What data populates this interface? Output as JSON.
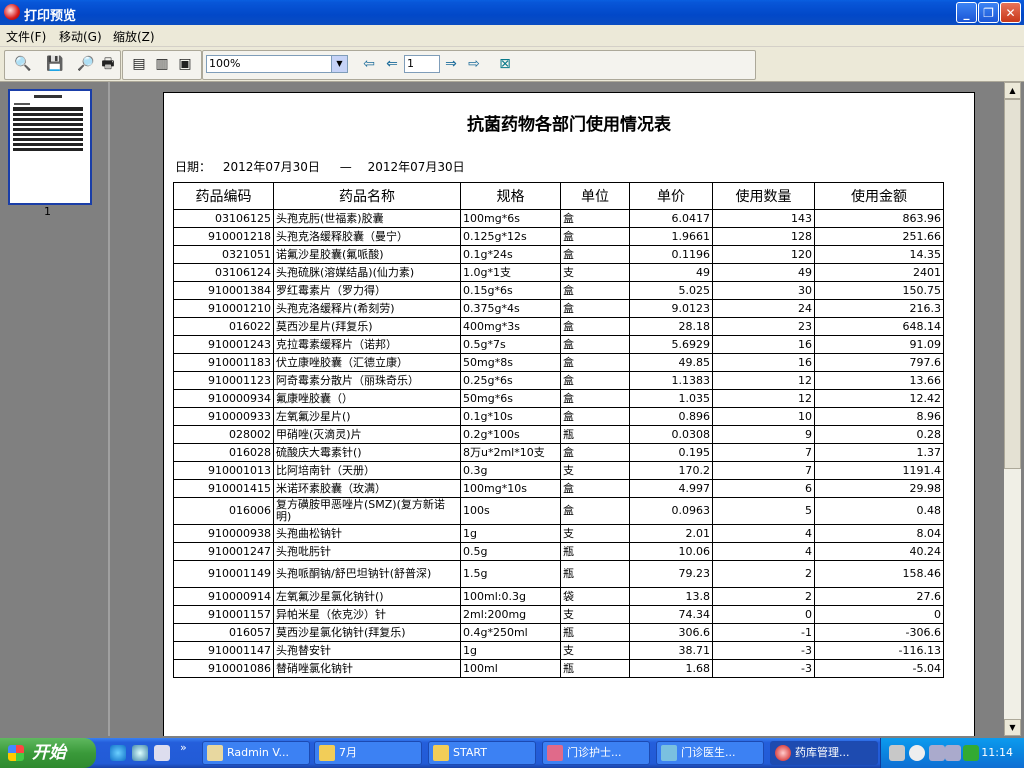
{
  "window": {
    "title": "打印预览",
    "minimize": "_",
    "maximize": "❐",
    "close": "✕"
  },
  "menu": [
    "文件(F)",
    "移动(G)",
    "缩放(Z)"
  ],
  "toolbar": {
    "zoom_value": "100%",
    "page_value": "1"
  },
  "thumbnails": {
    "page_label": "1"
  },
  "report": {
    "title": "抗菌药物各部门使用情况表",
    "date_label": "日期：",
    "date_from": "2012年07月30日",
    "date_sep": "—",
    "date_to": "2012年07月30日",
    "columns": [
      "药品编码",
      "药品名称",
      "规格",
      "单位",
      "单价",
      "使用数量",
      "使用金额"
    ],
    "rows": [
      [
        "03106125",
        "头孢克肟(世福素)胶囊",
        "100mg*6s",
        "盒",
        "6.0417",
        "143",
        "863.96"
      ],
      [
        "910001218",
        "头孢克洛缓释胶囊（曼宁）",
        "0.125g*12s",
        "盒",
        "1.9661",
        "128",
        "251.66"
      ],
      [
        "0321051",
        "诺氟沙星胶囊(氟哌酸)",
        "0.1g*24s",
        "盒",
        "0.1196",
        "120",
        "14.35"
      ],
      [
        "03106124",
        "头孢硫脒(溶媒结晶)(仙力素)",
        "1.0g*1支",
        "支",
        "49",
        "49",
        "2401"
      ],
      [
        "910001384",
        "罗红霉素片（罗力得）",
        "0.15g*6s",
        "盒",
        "5.025",
        "30",
        "150.75"
      ],
      [
        "910001210",
        "头孢克洛缓释片(希刻劳)",
        "0.375g*4s",
        "盒",
        "9.0123",
        "24",
        "216.3"
      ],
      [
        "016022",
        "莫西沙星片(拜复乐)",
        "400mg*3s",
        "盒",
        "28.18",
        "23",
        "648.14"
      ],
      [
        "910001243",
        "克拉霉素缓释片（诺邦）",
        "0.5g*7s",
        "盒",
        "5.6929",
        "16",
        "91.09"
      ],
      [
        "910001183",
        "伏立康唑胶囊（汇德立康）",
        "50mg*8s",
        "盒",
        "49.85",
        "16",
        "797.6"
      ],
      [
        "910001123",
        "阿奇霉素分散片（丽珠奇乐）",
        "0.25g*6s",
        "盒",
        "1.1383",
        "12",
        "13.66"
      ],
      [
        "910000934",
        "氟康唑胶囊（）",
        "50mg*6s",
        "盒",
        "1.035",
        "12",
        "12.42"
      ],
      [
        "910000933",
        "左氧氟沙星片()",
        "0.1g*10s",
        "盒",
        "0.896",
        "10",
        "8.96"
      ],
      [
        "028002",
        "甲硝唑(灭滴灵)片",
        "0.2g*100s",
        "瓶",
        "0.0308",
        "9",
        "0.28"
      ],
      [
        "016028",
        "硫酸庆大霉素针()",
        "8万u*2ml*10支",
        "盒",
        "0.195",
        "7",
        "1.37"
      ],
      [
        "910001013",
        "比阿培南针（天册）",
        "0.3g",
        "支",
        "170.2",
        "7",
        "1191.4"
      ],
      [
        "910001415",
        "米诺环素胶囊（玫满）",
        "100mg*10s",
        "盒",
        "4.997",
        "6",
        "29.98"
      ],
      [
        "016006",
        "复方磺胺甲恶唑片(SMZ)(复方新诺明)",
        "100s",
        "盒",
        "0.0963",
        "5",
        "0.48"
      ],
      [
        "910000938",
        "头孢曲松钠针",
        "1g",
        "支",
        "2.01",
        "4",
        "8.04"
      ],
      [
        "910001247",
        "头孢吡肟针",
        "0.5g",
        "瓶",
        "10.06",
        "4",
        "40.24"
      ],
      [
        "910001149",
        "头孢哌酮钠/舒巴坦钠针(舒普深)",
        "1.5g",
        "瓶",
        "79.23",
        "2",
        "158.46"
      ],
      [
        "910000914",
        "左氧氟沙星氯化钠针()",
        "100ml:0.3g",
        "袋",
        "13.8",
        "2",
        "27.6"
      ],
      [
        "910001157",
        "异帕米星（依克沙）针",
        "2ml:200mg",
        "支",
        "74.34",
        "0",
        "0"
      ],
      [
        "016057",
        "莫西沙星氯化钠针(拜复乐)",
        "0.4g*250ml",
        "瓶",
        "306.6",
        "-1",
        "-306.6"
      ],
      [
        "910001147",
        "头孢替安针",
        "1g",
        "支",
        "38.71",
        "-3",
        "-116.13"
      ],
      [
        "910001086",
        "替硝唑氯化钠针",
        "100ml",
        "瓶",
        "1.68",
        "-3",
        "-5.04"
      ]
    ]
  },
  "taskbar": {
    "start_label": "开始",
    "tasks": [
      "Radmin V...",
      "7月",
      "START",
      "门诊护士...",
      "门诊医生...",
      "药库管理..."
    ],
    "clock": "11:14"
  }
}
